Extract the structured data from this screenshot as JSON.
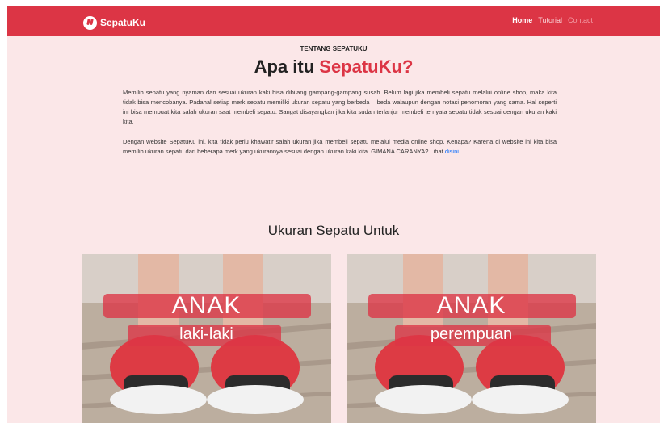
{
  "navbar": {
    "brand": "SepatuKu",
    "links": [
      "Home",
      "Tutorial",
      "Contact"
    ]
  },
  "about": {
    "kicker": "TENTANG SEPATUKU",
    "title_prefix": "Apa itu ",
    "title_accent": "SepatuKu?",
    "paragraph1": "Memilih sepatu yang nyaman dan sesuai ukuran kaki bisa dibilang gampang-gampang susah. Belum lagi jika membeli sepatu melalui online shop, maka kita tidak bisa mencobanya. Padahal setiap merk sepatu memiliki ukuran sepatu yang berbeda – beda walaupun dengan notasi penomoran yang sama. Hal seperti ini bisa membuat kita salah ukuran saat membeli sepatu. Sangat disayangkan jika kita sudah terlanjur membeli ternyata sepatu tidak sesuai dengan ukuran kaki kita.",
    "paragraph2": "Dengan website SepatuKu ini, kita tidak perlu khawatir salah ukuran jika membeli sepatu melalui media online shop. Kenapa? Karena di website ini kita bisa memilih ukuran sepatu dari beberapa merk yang ukurannya sesuai dengan ukuran kaki kita. GIMANA CARANYA? Lihat ",
    "link_text": "disini"
  },
  "sizes": {
    "title": "Ukuran Sepatu Untuk",
    "cards": [
      {
        "title": "ANAK",
        "subtitle": "laki-laki"
      },
      {
        "title": "ANAK",
        "subtitle": "perempuan"
      }
    ]
  },
  "colors": {
    "accent": "#dc3545",
    "background": "#fbe7e8",
    "link": "#0d6efd"
  }
}
